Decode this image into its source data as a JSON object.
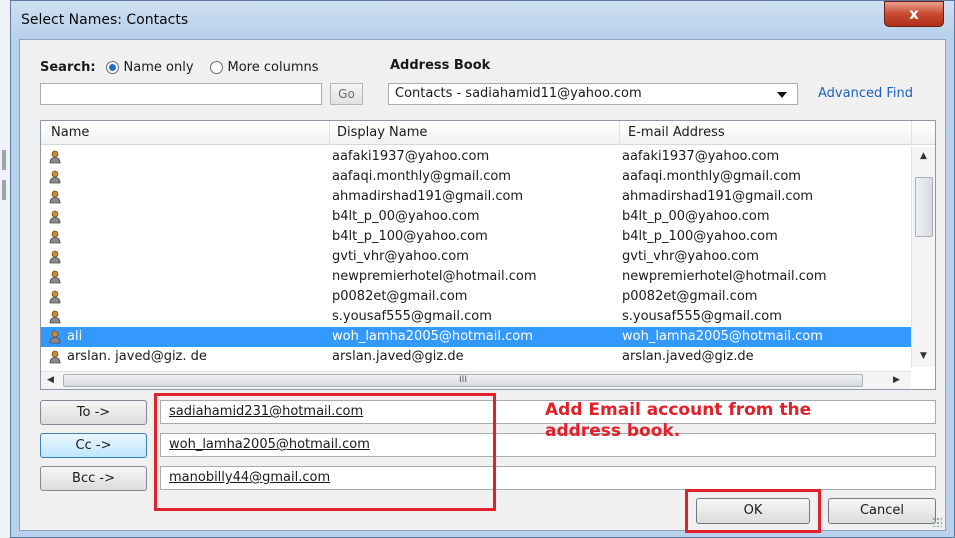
{
  "window": {
    "title": "Select Names: Contacts",
    "close_icon": "x"
  },
  "search": {
    "label": "Search:",
    "option_name_only": "Name only",
    "option_more_columns": "More columns",
    "selected": "Name only",
    "input_value": "",
    "go_label": "Go"
  },
  "address_book": {
    "label": "Address Book",
    "selected": "Contacts - sadiahamid11@yahoo.com",
    "advanced_find": "Advanced Find"
  },
  "list": {
    "columns": [
      "Name",
      "Display Name",
      "E-mail Address"
    ],
    "rows": [
      {
        "name": "",
        "display": "aafaki1937@yahoo.com",
        "email": "aafaki1937@yahoo.com",
        "selected": false
      },
      {
        "name": "",
        "display": "aafaqi.monthly@gmail.com",
        "email": "aafaqi.monthly@gmail.com",
        "selected": false
      },
      {
        "name": "",
        "display": "ahmadirshad191@gmail.com",
        "email": "ahmadirshad191@gmail.com",
        "selected": false
      },
      {
        "name": "",
        "display": "b4lt_p_00@yahoo.com",
        "email": "b4lt_p_00@yahoo.com",
        "selected": false
      },
      {
        "name": "",
        "display": "b4lt_p_100@yahoo.com",
        "email": "b4lt_p_100@yahoo.com",
        "selected": false
      },
      {
        "name": "",
        "display": "gvti_vhr@yahoo.com",
        "email": "gvti_vhr@yahoo.com",
        "selected": false
      },
      {
        "name": "",
        "display": "newpremierhotel@hotmail.com",
        "email": "newpremierhotel@hotmail.com",
        "selected": false
      },
      {
        "name": "",
        "display": "p0082et@gmail.com",
        "email": "p0082et@gmail.com",
        "selected": false
      },
      {
        "name": "",
        "display": "s.yousaf555@gmail.com",
        "email": "s.yousaf555@gmail.com",
        "selected": false
      },
      {
        "name": "ali",
        "display": "woh_lamha2005@hotmail.com",
        "email": "woh_lamha2005@hotmail.com",
        "selected": true
      },
      {
        "name": "arslan. javed@giz. de",
        "display": "arslan.javed@giz.de",
        "email": "arslan.javed@giz.de",
        "selected": false
      }
    ],
    "hscroll_grip": "III"
  },
  "recipients": {
    "to_label": "To ->",
    "to_value": "sadiahamid231@hotmail.com",
    "cc_label": "Cc ->",
    "cc_value": "woh_lamha2005@hotmail.com",
    "bcc_label": "Bcc ->",
    "bcc_value": "manobilly44@gmail.com"
  },
  "annotation": {
    "text": "Add Email account from the address book."
  },
  "buttons": {
    "ok": "OK",
    "cancel": "Cancel"
  },
  "colors": {
    "selection": "#3399ff",
    "annotation": "#e0202a",
    "link": "#1f5fbf"
  }
}
